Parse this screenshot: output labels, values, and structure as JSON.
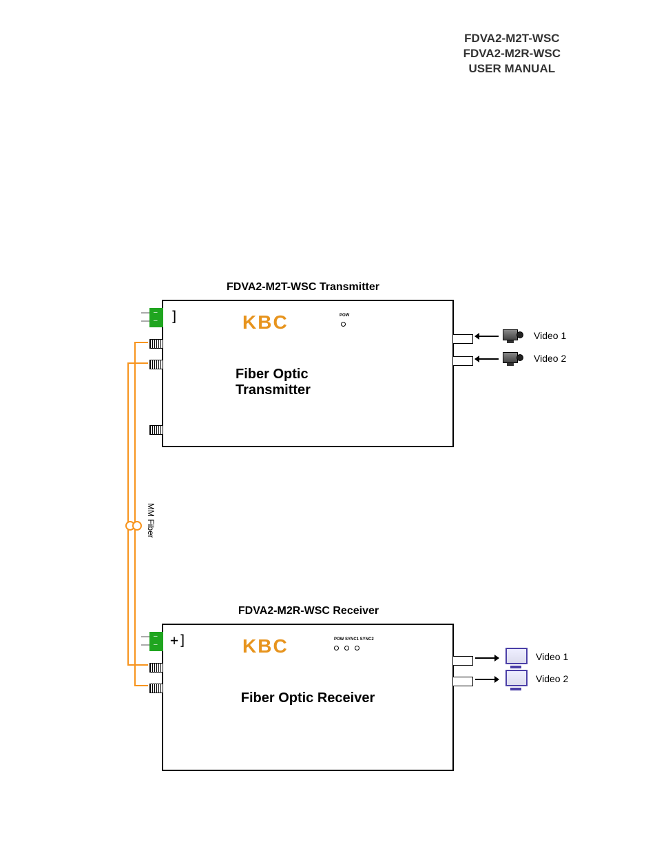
{
  "header": {
    "line1": "FDVA2-M2T-WSC",
    "line2": "FDVA2-M2R-WSC",
    "line3": "USER MANUAL"
  },
  "transmitter": {
    "title": "FDVA2-M2T-WSC Transmitter",
    "brand": "KBC",
    "big_label": "Fiber Optic Transmitter",
    "pow_label": "POW",
    "video1_label": "Video 1",
    "video2_label": "Video 2"
  },
  "receiver": {
    "title": "FDVA2-M2R-WSC Receiver",
    "brand": "KBC",
    "big_label": "Fiber Optic Receiver",
    "leds_label": "POW SYNC1 SYNC2",
    "video1_label": "Video 1",
    "video2_label": "Video 2"
  },
  "fiber": {
    "label": "MM Fiber"
  }
}
